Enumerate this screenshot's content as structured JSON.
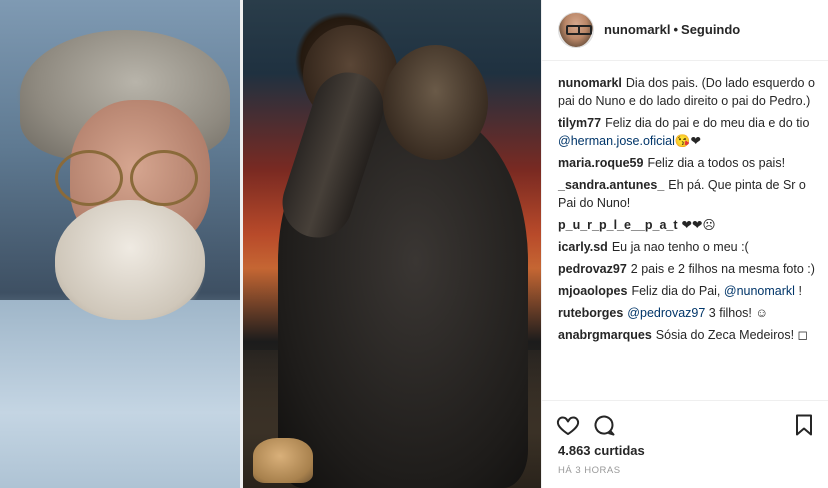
{
  "post": {
    "username": "nunomarkl",
    "separator": "•",
    "follow_status": "Seguindo",
    "likes": "4.863 curtidas",
    "time": "HÁ 3 HORAS"
  },
  "comments": [
    {
      "user": "nunomarkl",
      "text": "Dia dos pais. (Do lado esquerdo o pai do Nuno e do lado direito o pai do Pedro.)"
    },
    {
      "user": "tilym77",
      "text": "Feliz dia do pai e do meu dia e do tio",
      "mention": "@herman.jose.oficial",
      "suffix": "😘❤"
    },
    {
      "user": "maria.roque59",
      "text": "Feliz dia a todos os pais!"
    },
    {
      "user": "_sandra.antunes_",
      "text": "Eh pá. Que pinta de Sr o Pai do Nuno!"
    },
    {
      "user": "p_u_r_p_l_e__p_a_t",
      "text": "❤❤☹"
    },
    {
      "user": "icarly.sd",
      "text": "Eu ja nao tenho o meu :("
    },
    {
      "user": "pedrovaz97",
      "text": "2 pais e 2 filhos na mesma foto :)"
    },
    {
      "user": "mjoaolopes",
      "text": "Feliz dia do Pai,",
      "mention": "@nunomarkl",
      "suffix": "!"
    },
    {
      "user": "ruteborges",
      "text": "",
      "mention": "@pedrovaz97",
      "suffix": "3 filhos! ☺"
    },
    {
      "user": "anabrgmarques",
      "text": "Sósia do Zeca Medeiros! ◻"
    }
  ],
  "icons": {
    "like": "heart-icon",
    "comment": "comment-icon",
    "save": "bookmark-icon"
  },
  "colors": {
    "text": "#262626",
    "mention": "#003569",
    "muted": "#999999",
    "border": "#efefef"
  }
}
